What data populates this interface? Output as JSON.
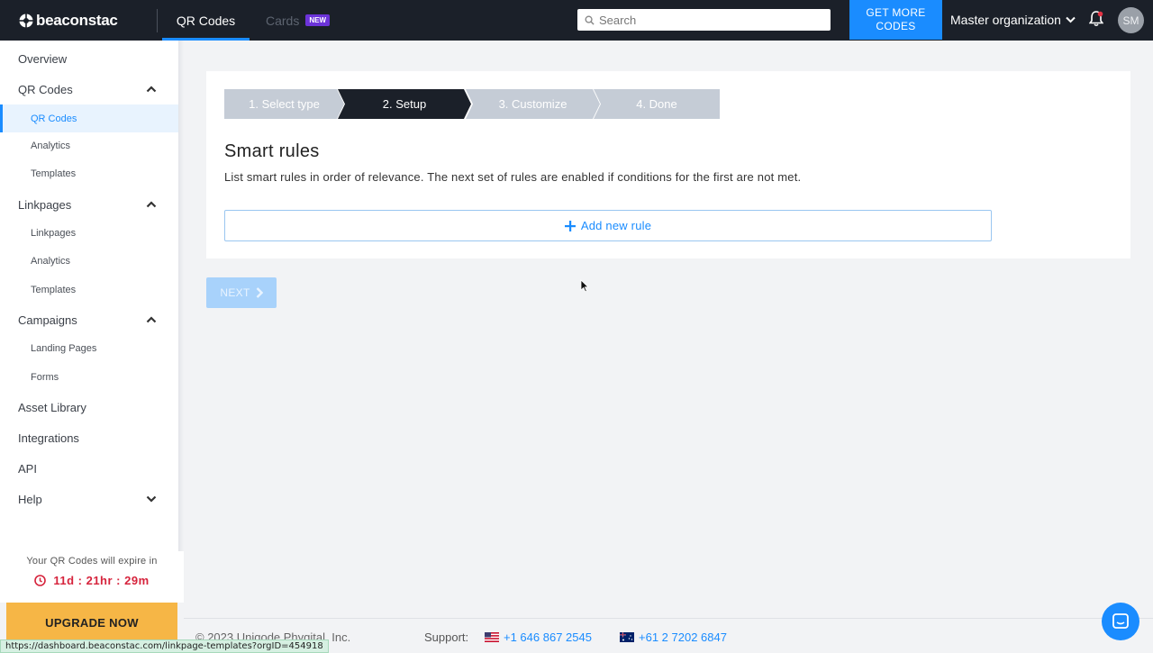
{
  "topbar": {
    "logo_text": "beaconstac",
    "tabs": [
      {
        "label": "QR Codes",
        "active": true
      },
      {
        "label": "Cards",
        "badge": "NEW"
      }
    ],
    "search_placeholder": "Search",
    "cta_line1": "GET MORE",
    "cta_line2": "CODES",
    "org_name": "Master organization",
    "avatar_initials": "SM"
  },
  "sidebar": {
    "overview": "Overview",
    "qr_section": "QR Codes",
    "qr_items": [
      "QR Codes",
      "Analytics",
      "Templates"
    ],
    "linkpages_section": "Linkpages",
    "linkpages_items": [
      "Linkpages",
      "Analytics",
      "Templates"
    ],
    "campaigns_section": "Campaigns",
    "campaigns_items": [
      "Landing Pages",
      "Forms"
    ],
    "asset_library": "Asset Library",
    "integrations": "Integrations",
    "api": "API",
    "help": "Help",
    "expire_text": "Your QR Codes will expire in",
    "timer": "11d : 21hr : 29m",
    "upgrade_label": "UPGRADE NOW"
  },
  "wizard": {
    "steps": [
      {
        "label": "1. Select type",
        "state": "done"
      },
      {
        "label": "2. Setup",
        "state": "active"
      },
      {
        "label": "3. Customize",
        "state": "pending"
      },
      {
        "label": "4. Done",
        "state": "pending"
      }
    ],
    "title": "Smart rules",
    "description": "List smart rules in order of relevance. The next set of rules are enabled if conditions for the first are not met.",
    "add_rule_label": "Add new rule",
    "next_label": "NEXT"
  },
  "footer": {
    "copyright": "© 2023 Uniqode Phygital, Inc.",
    "support_label": "Support:",
    "phone_us": "+1 646 867 2545",
    "phone_au": "+61 2 7202 6847"
  },
  "status_bar_url": "https://dashboard.beaconstac.com/linkpage-templates?orgID=454918",
  "colors": {
    "topbar": "#1b2029",
    "accent": "#1a8cff",
    "upgrade": "#f6b646",
    "timer": "#d6233c",
    "step_active": "#1b2029",
    "step_inactive": "#c5ccd6"
  }
}
